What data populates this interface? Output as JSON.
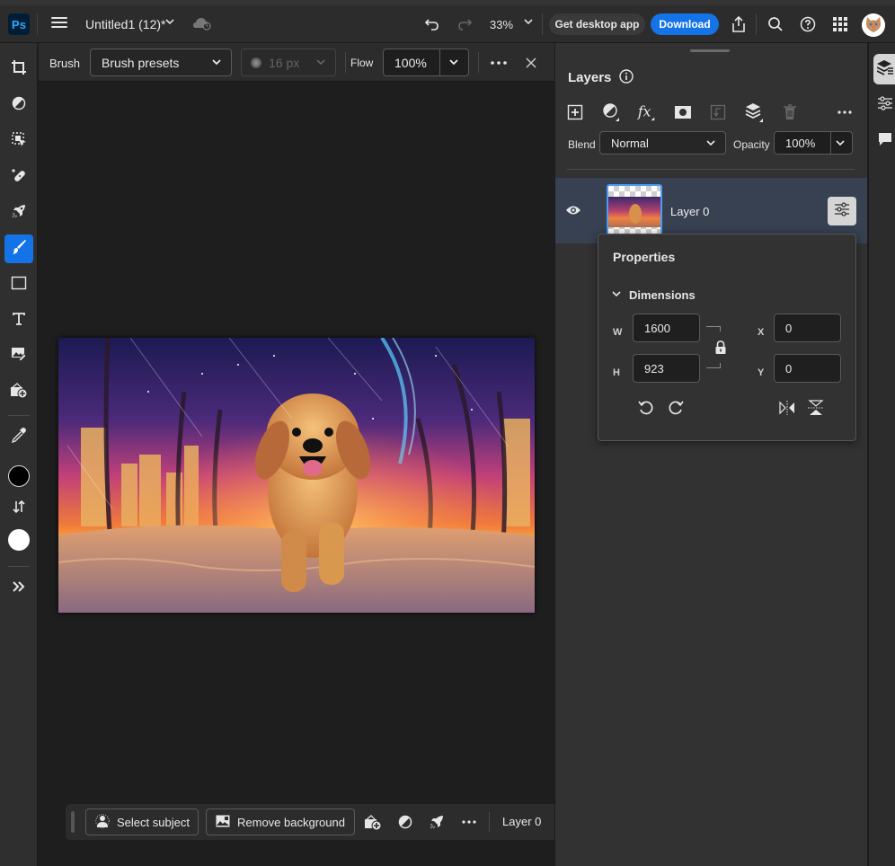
{
  "app": {
    "logo_text": "Ps",
    "document_title": "Untitled1 (12)*",
    "zoom_level": "33%",
    "get_desktop_label": "Get desktop app",
    "download_label": "Download",
    "accent_color": "#1473e6"
  },
  "tools": [
    {
      "name": "crop-tool",
      "icon": "crop-icon",
      "active": false
    },
    {
      "name": "adjustment-tool",
      "icon": "half-circle-icon",
      "active": false
    },
    {
      "name": "object-select-tool",
      "icon": "selection-icon",
      "active": false
    },
    {
      "name": "healing-tool",
      "icon": "bandage-icon",
      "active": false
    },
    {
      "name": "quick-actions-tool",
      "icon": "rocket-icon",
      "active": false
    },
    {
      "name": "brush-tool",
      "icon": "brush-icon",
      "active": true
    },
    {
      "name": "shape-tool",
      "icon": "rectangle-icon",
      "active": false
    },
    {
      "name": "type-tool",
      "icon": "type-icon",
      "active": false
    },
    {
      "name": "place-image-tool",
      "icon": "image-edit-icon",
      "active": false
    },
    {
      "name": "add-image-tool",
      "icon": "image-add-icon",
      "active": false
    },
    {
      "name": "eyedropper-tool",
      "icon": "eyedropper-icon",
      "active": false
    }
  ],
  "colors": {
    "foreground": "#000000",
    "background": "#ffffff"
  },
  "options_bar": {
    "tool_label": "Brush",
    "preset_dropdown": "Brush presets",
    "size_value": "16 px",
    "flow_label": "Flow",
    "flow_value": "100%"
  },
  "context_bar": {
    "select_subject_label": "Select subject",
    "remove_background_label": "Remove background",
    "layer_label": "Layer 0"
  },
  "layers_panel": {
    "title": "Layers",
    "blend_label": "Blend",
    "blend_value": "Normal",
    "opacity_label": "Opacity",
    "opacity_value": "100%",
    "layers": [
      {
        "name": "Layer 0",
        "visible": true,
        "selected": true
      }
    ]
  },
  "properties": {
    "title": "Properties",
    "section": "Dimensions",
    "w_label": "W",
    "h_label": "H",
    "x_label": "X",
    "y_label": "Y",
    "width": "1600",
    "height": "923",
    "x": "0",
    "y": "0"
  }
}
